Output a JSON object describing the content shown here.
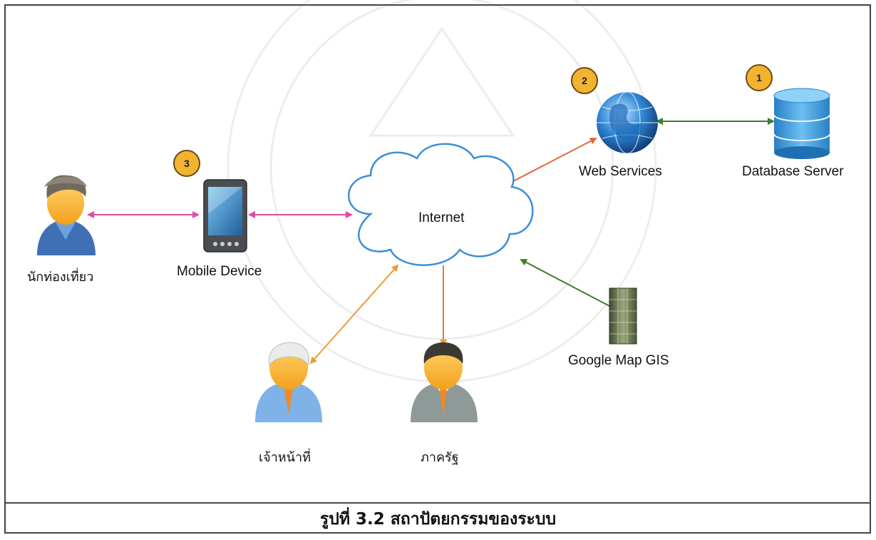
{
  "nodes": {
    "database_server": "Database Server",
    "web_services": "Web Services",
    "internet": "Internet",
    "mobile_device": "Mobile Device",
    "tourist": "นักท่องเที่ยว",
    "google_map": "Google Map GIS",
    "officer": "เจ้าหน้าที่",
    "government": "ภาครัฐ"
  },
  "badges": {
    "database_server": "1",
    "web_services": "2",
    "mobile_device": "3"
  },
  "caption": "รูปที่ 3.2 สถาปัตยกรรมของระบบ",
  "colors": {
    "green_link": "#3d7d2c",
    "orange_red_link": "#e06a3c",
    "pink_link": "#e04aa8",
    "orange_link": "#ee9a3a",
    "cloud_stroke": "#3d8fd9",
    "badge_fill": "#f2b331"
  }
}
